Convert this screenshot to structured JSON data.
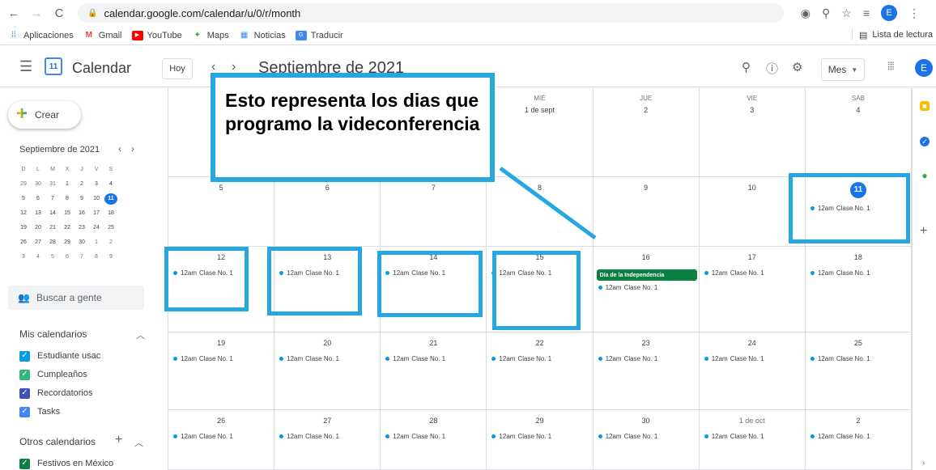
{
  "browser": {
    "url": "calendar.google.com/calendar/u/0/r/month",
    "profile_initial": "E",
    "bookmarks": [
      {
        "label": "Aplicaciones",
        "icon": "apps-grid-icon"
      },
      {
        "label": "Gmail",
        "icon": "gmail-icon"
      },
      {
        "label": "YouTube",
        "icon": "youtube-icon"
      },
      {
        "label": "Maps",
        "icon": "maps-icon"
      },
      {
        "label": "Noticias",
        "icon": "news-icon"
      },
      {
        "label": "Traducir",
        "icon": "translate-icon"
      }
    ],
    "reading_list": "Lista de lectura"
  },
  "header": {
    "app_name": "Calendar",
    "logo_number": "11",
    "today_label": "Hoy",
    "month_title": "Septiembre de 2021",
    "view_label": "Mes",
    "avatar_initial": "E"
  },
  "sidebar": {
    "create_label": "Crear",
    "mini_title": "Septiembre de 2021",
    "mini_headers": [
      "D",
      "L",
      "M",
      "X",
      "J",
      "V",
      "S"
    ],
    "mini_weeks": [
      [
        "29",
        "30",
        "31",
        "1",
        "2",
        "3",
        "4"
      ],
      [
        "5",
        "6",
        "7",
        "8",
        "9",
        "10",
        "11"
      ],
      [
        "12",
        "13",
        "14",
        "15",
        "16",
        "17",
        "18"
      ],
      [
        "19",
        "20",
        "21",
        "22",
        "23",
        "24",
        "25"
      ],
      [
        "26",
        "27",
        "28",
        "29",
        "30",
        "1",
        "2"
      ],
      [
        "3",
        "4",
        "5",
        "6",
        "7",
        "8",
        "9"
      ]
    ],
    "people_placeholder": "Buscar a gente",
    "my_calendars_title": "Mis calendarios",
    "my_calendars": [
      {
        "label": "Estudiante usac",
        "color": "#039be5"
      },
      {
        "label": "Cumpleaños",
        "color": "#33b679"
      },
      {
        "label": "Recordatorios",
        "color": "#3f51b5"
      },
      {
        "label": "Tasks",
        "color": "#4285f4"
      }
    ],
    "other_calendars_title": "Otros calendarios",
    "other_calendars": [
      {
        "label": "Festivos en México",
        "color": "#0b8043"
      }
    ]
  },
  "calendar": {
    "weekday_headers": [
      "",
      "",
      "",
      "MIÉ",
      "JUE",
      "VIE",
      "SÁB"
    ],
    "event_time": "12am",
    "event_title": "Clase No. 1",
    "holiday_title": "Día de la Independencia",
    "weeks": [
      [
        {
          "d": ""
        },
        {
          "d": ""
        },
        {
          "d": ""
        },
        {
          "d": "1 de sept"
        },
        {
          "d": "2"
        },
        {
          "d": "3"
        },
        {
          "d": "4"
        }
      ],
      [
        {
          "d": "5"
        },
        {
          "d": "6"
        },
        {
          "d": "7"
        },
        {
          "d": "8"
        },
        {
          "d": "9"
        },
        {
          "d": "10"
        },
        {
          "d": "11",
          "today": true,
          "ev": true
        }
      ],
      [
        {
          "d": "12",
          "ev": true
        },
        {
          "d": "13",
          "ev": true
        },
        {
          "d": "14",
          "ev": true
        },
        {
          "d": "15",
          "ev": true
        },
        {
          "d": "16",
          "holiday": true,
          "ev": true
        },
        {
          "d": "17",
          "ev": true
        },
        {
          "d": "18",
          "ev": true
        }
      ],
      [
        {
          "d": "19",
          "ev": true
        },
        {
          "d": "20",
          "ev": true
        },
        {
          "d": "21",
          "ev": true
        },
        {
          "d": "22",
          "ev": true
        },
        {
          "d": "23",
          "ev": true
        },
        {
          "d": "24",
          "ev": true
        },
        {
          "d": "25",
          "ev": true
        }
      ],
      [
        {
          "d": "26",
          "ev": true
        },
        {
          "d": "27",
          "ev": true
        },
        {
          "d": "28",
          "ev": true
        },
        {
          "d": "29",
          "ev": true
        },
        {
          "d": "30",
          "ev": true
        },
        {
          "d": "1 de oct",
          "dim": true,
          "ev": true
        },
        {
          "d": "2",
          "ev": true
        }
      ]
    ]
  },
  "annotation": {
    "callout_text": "Esto representa los dias que programo la videconferencia",
    "color": "#27a7e0"
  }
}
